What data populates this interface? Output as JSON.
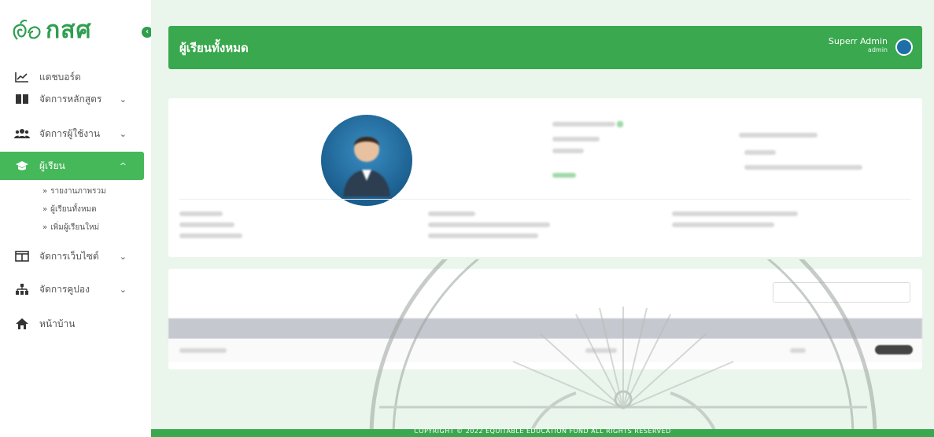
{
  "brand": {
    "logo_text": "กสศ",
    "accent": "#3aa84e",
    "accent_light": "#45b85a"
  },
  "sidebar": {
    "items": [
      {
        "label": "แดชบอร์ด",
        "icon": "chart-line-icon",
        "has_children": false
      },
      {
        "label": "จัดการหลักสูตร",
        "icon": "book-icon",
        "has_children": true
      },
      {
        "label": "จัดการผู้ใช้งาน",
        "icon": "users-icon",
        "has_children": true
      },
      {
        "label": "ผู้เรียน",
        "icon": "graduation-cap-icon",
        "has_children": true,
        "active": true
      },
      {
        "label": "จัดการเว็บไซต์",
        "icon": "columns-icon",
        "has_children": true
      },
      {
        "label": "จัดการคูปอง",
        "icon": "sitemap-icon",
        "has_children": true
      },
      {
        "label": "หน้าบ้าน",
        "icon": "home-icon",
        "has_children": false
      }
    ],
    "sub_items": [
      {
        "label": "รายงานภาพรวม"
      },
      {
        "label": "ผู้เรียนทั้งหมด"
      },
      {
        "label": "เพิ่มผู้เรียนใหม่"
      }
    ],
    "chevron": "⌄",
    "sub_bullet": "»"
  },
  "header": {
    "title": "ผู้เรียนทั้งหมด",
    "user_name": "Superr Admin",
    "user_role": "admin"
  },
  "footer": {
    "text": "COPYRIGHT © 2022 EQUITABLE EDUCATION FUND ALL RIGHTS RESERVED"
  }
}
